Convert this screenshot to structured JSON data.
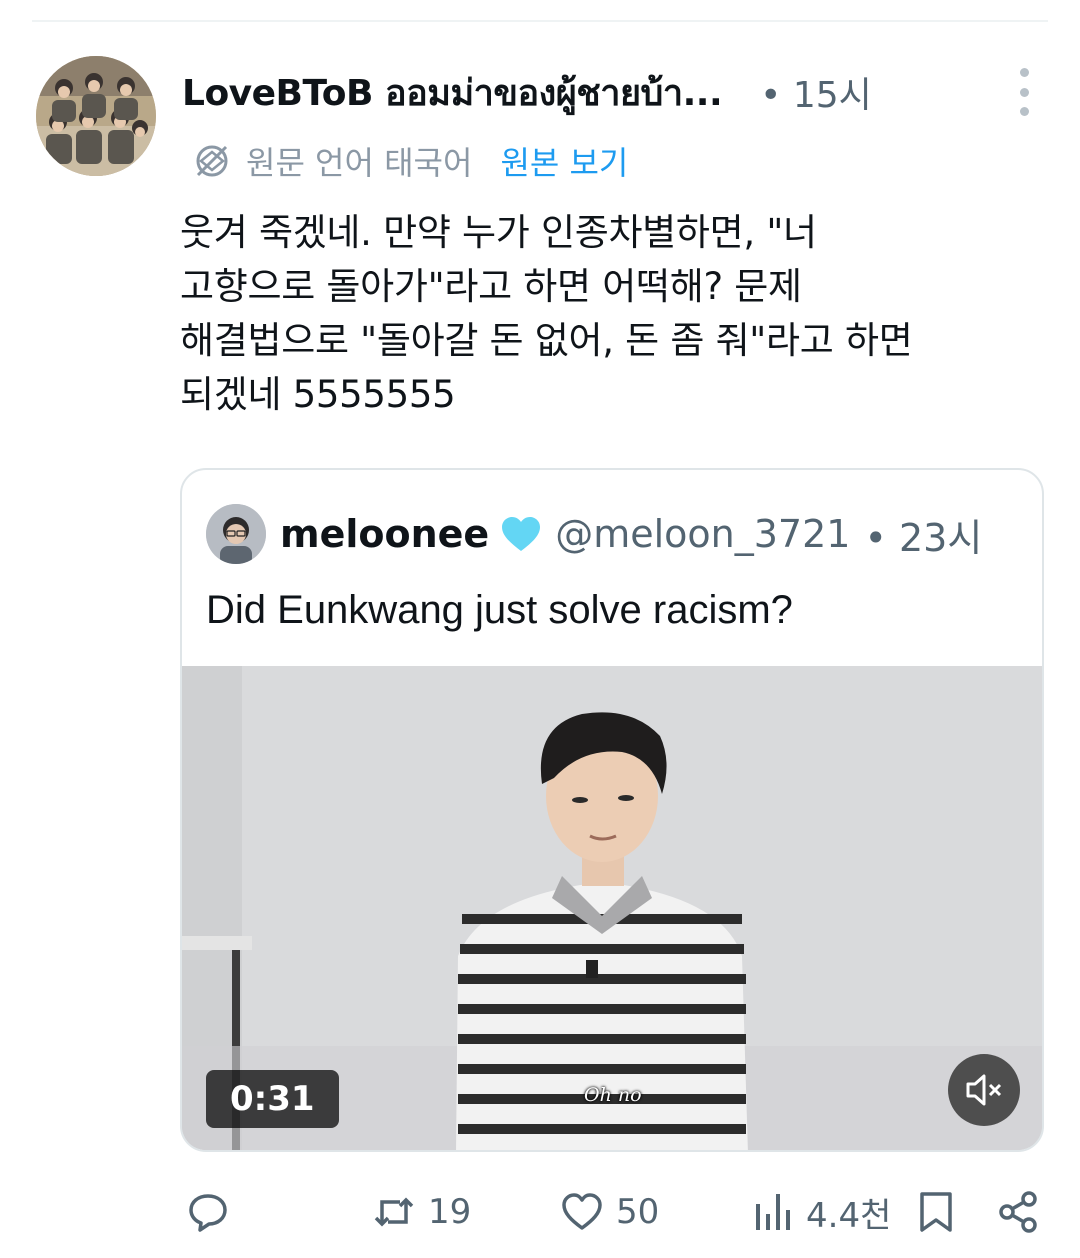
{
  "tweet": {
    "author": {
      "display_name": "LoveBToB ออมม่าของผู้ชายบ้า...",
      "time": "• 15시"
    },
    "translation": {
      "note": "원문 언어 태국어",
      "link": "원본 보기"
    },
    "text": "웃겨 죽겠네. 만약 누가 인종차별하면, \"너\n고향으로 돌아가\"라고 하면 어떡해? 문제\n해결법으로 \"돌아갈 돈 없어, 돈 좀 줘\"라고 하면\n되겠네 5555555"
  },
  "quote": {
    "name": "meloonee",
    "handle": "@meloon_3721",
    "time": "• 23시",
    "text": "Did Eunkwang just solve racism?",
    "video": {
      "duration": "0:31",
      "subtitle": "Oh no"
    }
  },
  "actions": {
    "replies": "",
    "retweets": "19",
    "likes": "50",
    "views": "4.4천"
  },
  "colors": {
    "accent": "#1d9bf0",
    "secondary_text": "#536471",
    "verified_heart": "#63d6f4"
  }
}
